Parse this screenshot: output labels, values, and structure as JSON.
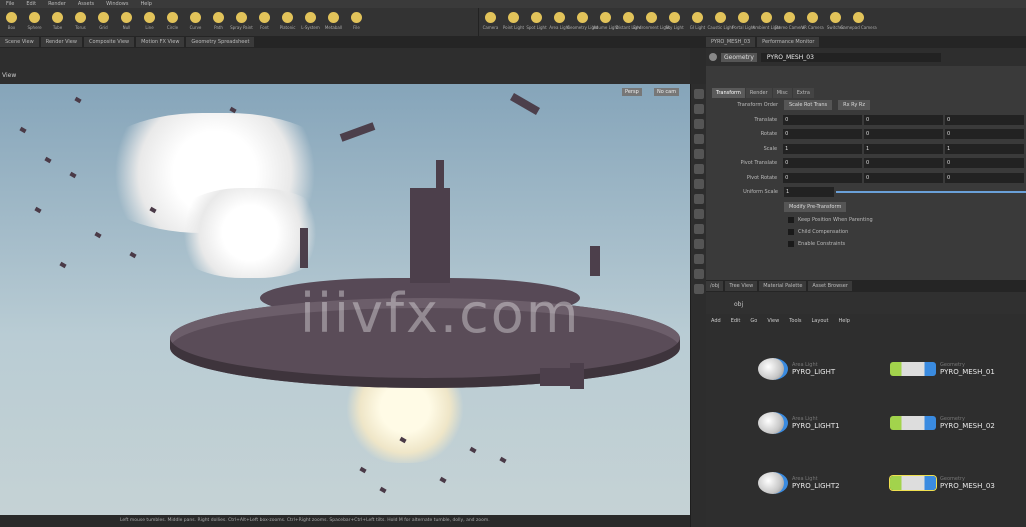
{
  "menu": [
    "File",
    "Edit",
    "Render",
    "Assets",
    "Windows",
    "Help"
  ],
  "shelf_left_tools": [
    "Box",
    "Sphere",
    "Tube",
    "Torus",
    "Grid",
    "Null",
    "Line",
    "Circle",
    "Curve",
    "Path",
    "Spray Paint",
    "Font",
    "Platonic",
    "L-System",
    "Metaball",
    "File"
  ],
  "shelf_right_tools": [
    "Camera",
    "Point Light",
    "Spot Light",
    "Area Light",
    "Geometry Light",
    "Volume Light",
    "Distant Light",
    "Environment Light",
    "Sky Light",
    "GI Light",
    "Caustic Light",
    "Portal Light",
    "Ambient Light",
    "Stereo Camera",
    "VR Camera",
    "Switcher",
    "Gamepad Camera"
  ],
  "viewport": {
    "tabs": [
      "Scene View",
      "Render View",
      "Composite View",
      "Motion FX View",
      "Geometry Spreadsheet"
    ],
    "path": "obj",
    "view_label": "View",
    "persp_label": "Persp",
    "cam_label": "No cam",
    "status_text": "Left mouse tumbles. Middle pans. Right dollies. Ctrl+Alt+Left box-zooms. Ctrl+Right zooms. Spacebar+Ctrl+Left tilts. Hold M for alternate tumble, dolly, and zoom."
  },
  "params": {
    "tabs": [
      "PYRO_MESH_03",
      "Performance Monitor"
    ],
    "node_type": "Geometry",
    "node_name": "PYRO_MESH_03",
    "sub_tabs": [
      "Transform",
      "Render",
      "Misc",
      "Extra"
    ],
    "rows": [
      {
        "label": "Transform Order",
        "values": [
          "Scale Rot Trans",
          "Rx Ry Rz"
        ]
      },
      {
        "label": "Translate",
        "values": [
          "0",
          "0",
          "0"
        ]
      },
      {
        "label": "Rotate",
        "values": [
          "0",
          "0",
          "0"
        ]
      },
      {
        "label": "Scale",
        "values": [
          "1",
          "1",
          "1"
        ]
      },
      {
        "label": "Pivot Translate",
        "values": [
          "0",
          "0",
          "0"
        ]
      },
      {
        "label": "Pivot Rotate",
        "values": [
          "0",
          "0",
          "0"
        ]
      },
      {
        "label": "Uniform Scale",
        "values": [
          "1"
        ]
      }
    ],
    "modify_button": "Modify Pre-Transform",
    "checks": [
      "Keep Position When Parenting",
      "Child Compensation",
      "Enable Constraints"
    ]
  },
  "network": {
    "tabs": [
      "/obj",
      "Tree View",
      "Material Palette",
      "Asset Browser"
    ],
    "path": "obj",
    "menu": [
      "Add",
      "Edit",
      "Go",
      "View",
      "Tools",
      "Layout",
      "Help"
    ],
    "nodes": [
      {
        "type": "Area Light",
        "name": "PYRO_LIGHT",
        "kind": "light"
      },
      {
        "type": "Geometry",
        "name": "PYRO_MESH_01",
        "kind": "geo"
      },
      {
        "type": "Area Light",
        "name": "PYRO_LIGHT1",
        "kind": "light"
      },
      {
        "type": "Geometry",
        "name": "PYRO_MESH_02",
        "kind": "geo"
      },
      {
        "type": "Area Light",
        "name": "PYRO_LIGHT2",
        "kind": "light"
      },
      {
        "type": "Geometry",
        "name": "PYRO_MESH_03",
        "kind": "geo"
      }
    ]
  },
  "watermark": "iiivfx.com",
  "colors": {
    "accent_blue": "#3a8be0",
    "geo_green": "#a2d34c",
    "tool_yellow": "#e2c35a"
  }
}
